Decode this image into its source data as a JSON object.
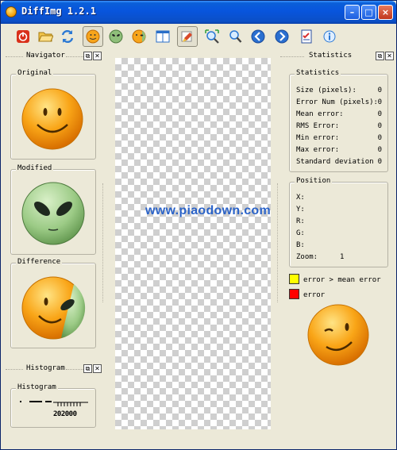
{
  "window": {
    "title": "DiffImg 1.2.1",
    "accent": "#0855dd"
  },
  "toolbar": {
    "buttons": [
      {
        "name": "power-icon"
      },
      {
        "name": "open-folder-icon"
      },
      {
        "name": "refresh-icon"
      },
      {
        "name": "smiley-original-icon"
      },
      {
        "name": "alien-modified-icon"
      },
      {
        "name": "smiley-difference-icon"
      },
      {
        "name": "split-view-icon"
      },
      {
        "name": "mask-icon"
      },
      {
        "name": "fit-zoom-icon"
      },
      {
        "name": "zoom-icon"
      },
      {
        "name": "previous-icon"
      },
      {
        "name": "next-icon"
      },
      {
        "name": "checklist-icon"
      },
      {
        "name": "info-icon"
      }
    ]
  },
  "navigator": {
    "title": "Navigator",
    "original_label": "Original",
    "modified_label": "Modified",
    "difference_label": "Difference"
  },
  "histogram": {
    "title": "Histogram",
    "group_label": "Histogram",
    "axis_text": "202000"
  },
  "statistics": {
    "title": "Statistics",
    "group_label": "Statistics",
    "rows": [
      {
        "label": "Size (pixels):",
        "value": "0"
      },
      {
        "label": "Error Num (pixels):",
        "value": "0"
      },
      {
        "label": "Mean error:",
        "value": "0"
      },
      {
        "label": "RMS Error:",
        "value": "0"
      },
      {
        "label": "Min error:",
        "value": "0"
      },
      {
        "label": "Max error:",
        "value": "0"
      },
      {
        "label": "Standard deviation",
        "value": "0"
      }
    ]
  },
  "position": {
    "group_label": "Position",
    "x_label": "X:",
    "y_label": "Y:",
    "r_label": "R:",
    "g_label": "G:",
    "b_label": "B:",
    "zoom_label": "Zoom:",
    "zoom_value": "1"
  },
  "legend": {
    "items": [
      {
        "label": "error > mean error",
        "color": "#ffff00"
      },
      {
        "label": "error",
        "color": "#ff0000"
      }
    ]
  },
  "watermark": "www.piaodown.com"
}
